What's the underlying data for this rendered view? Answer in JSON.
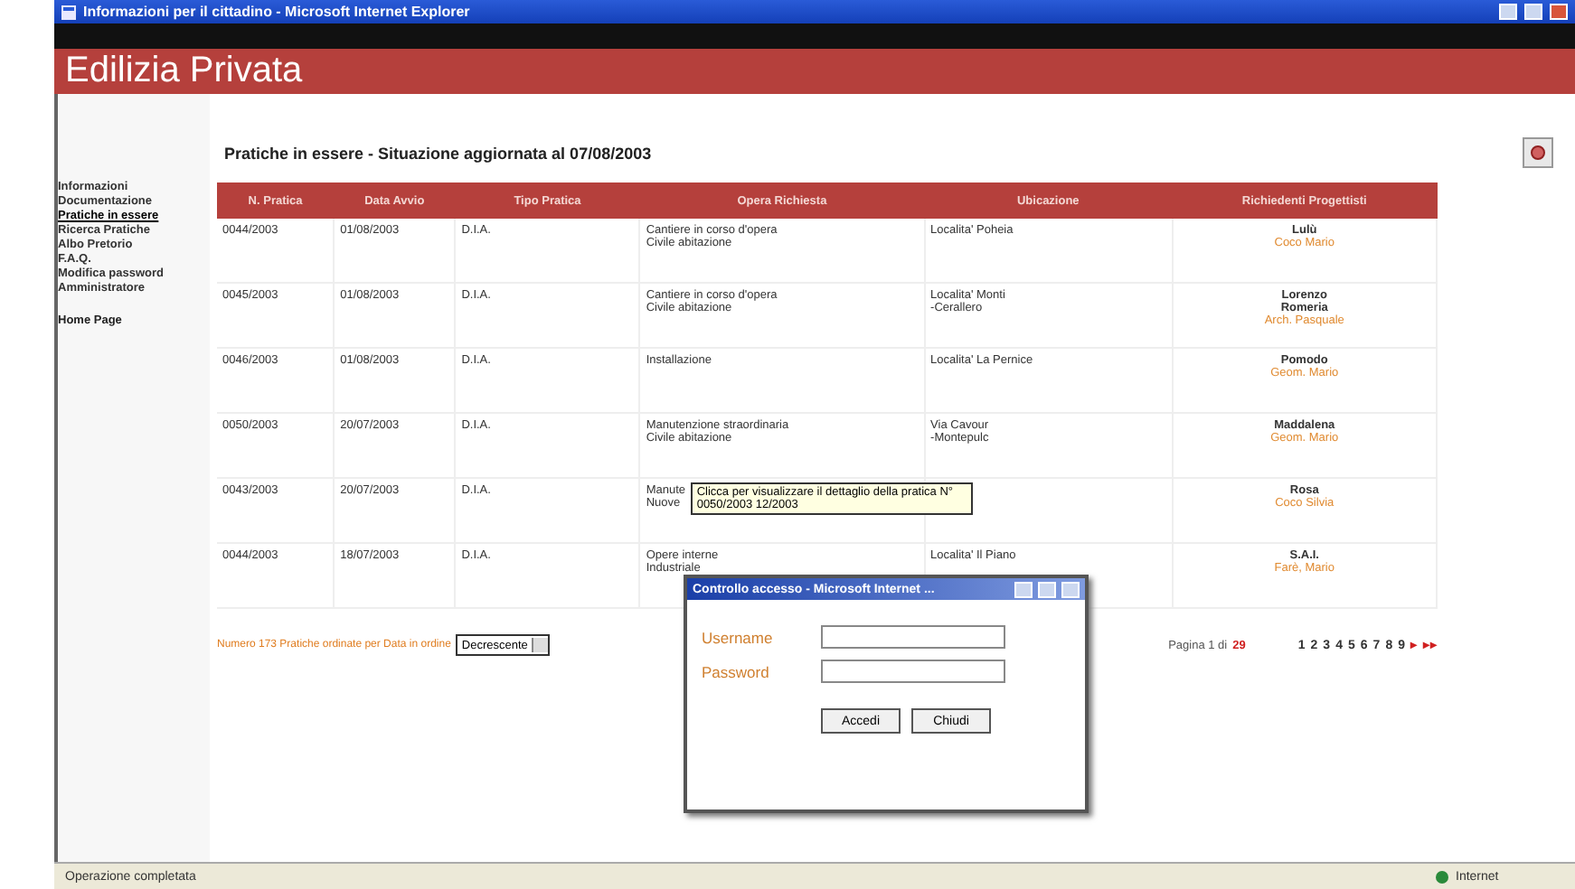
{
  "window": {
    "title": "Informazioni per il cittadino - Microsoft Internet Explorer"
  },
  "header": {
    "title": "Edilizia Privata"
  },
  "sidebar": {
    "items": [
      {
        "label": "Informazioni",
        "selected": false
      },
      {
        "label": "Documentazione",
        "selected": false
      },
      {
        "label": "Pratiche in essere",
        "selected": true
      },
      {
        "label": "Ricerca Pratiche",
        "selected": false
      },
      {
        "label": "Albo Pretorio",
        "selected": false
      },
      {
        "label": "F.A.Q.",
        "selected": false
      },
      {
        "label": "Modifica password",
        "selected": false
      },
      {
        "label": "Amministratore",
        "selected": false
      }
    ],
    "home": "Home Page"
  },
  "page_title": "Pratiche in essere - Situazione aggiornata al 07/08/2003",
  "table": {
    "columns": [
      "N. Pratica",
      "Data Avvio",
      "Tipo Pratica",
      "Opera Richiesta",
      "Ubicazione",
      "Richiedenti Progettisti"
    ],
    "rows": [
      {
        "number": "0044/2003",
        "date": "01/08/2003",
        "type": "D.I.A.",
        "opera": [
          "Cantiere in corso d'opera",
          "Civile abitazione"
        ],
        "location": [
          "Localita' Poheia"
        ],
        "applicant": "Lulù",
        "designer": "Coco Mario"
      },
      {
        "number": "0045/2003",
        "date": "01/08/2003",
        "type": "D.I.A.",
        "opera": [
          "Cantiere in corso d'opera",
          "Civile abitazione"
        ],
        "location": [
          "Localita' Monti",
          "-Cerallero"
        ],
        "applicant": "Lorenzo\nRomeria",
        "designer": "Arch. Pasquale"
      },
      {
        "number": "0046/2003",
        "date": "01/08/2003",
        "type": "D.I.A.",
        "opera": [
          "Installazione"
        ],
        "location": [
          "Localita' La Pernice"
        ],
        "applicant": "Pomodo",
        "designer": "Geom. Mario"
      },
      {
        "number": "0050/2003",
        "date": "20/07/2003",
        "type": "D.I.A.",
        "opera": [
          "Manutenzione straordinaria",
          "Civile abitazione"
        ],
        "location": [
          "Via Cavour",
          "-Montepulc"
        ],
        "applicant": "Maddalena",
        "designer": "Geom. Mario"
      },
      {
        "number": "0043/2003",
        "date": "20/07/2003",
        "type": "D.I.A.",
        "opera": [
          "Manute",
          "Nuove"
        ],
        "location": [],
        "applicant": "Rosa",
        "designer": "Coco Silvia",
        "tooltip": "Clicca per visualizzare il dettaglio della pratica N° 0050/2003 12/2003"
      },
      {
        "number": "0044/2003",
        "date": "18/07/2003",
        "type": "D.I.A.",
        "opera": [
          "Opere interne",
          "Industriale"
        ],
        "location": [
          "Localita' Il Piano"
        ],
        "applicant": "S.A.I.",
        "designer": "Farè, Mario"
      }
    ]
  },
  "footer": {
    "summary": "Numero 173 Pratiche ordinate per Data in ordine",
    "order": "Decrescente",
    "page_label": "Pagina 1 di",
    "page_total": "29",
    "pages": [
      {
        "label": "1",
        "kind": "number"
      },
      {
        "label": "2",
        "kind": "number"
      },
      {
        "label": "3",
        "kind": "number"
      },
      {
        "label": "4",
        "kind": "number"
      },
      {
        "label": "5",
        "kind": "number"
      },
      {
        "label": "6",
        "kind": "number"
      },
      {
        "label": "7",
        "kind": "number"
      },
      {
        "label": "8",
        "kind": "number"
      },
      {
        "label": "9",
        "kind": "number"
      },
      {
        "label": "▸",
        "kind": "arrow"
      },
      {
        "label": "▸▸",
        "kind": "arrow"
      }
    ]
  },
  "dialog": {
    "title": "Controllo accesso - Microsoft Internet ...",
    "fields": [
      {
        "label": "Username"
      },
      {
        "label": "Password"
      }
    ],
    "buttons": [
      "Accedi",
      "Chiudi"
    ]
  },
  "status_bar": {
    "text": "Operazione completata",
    "zone": "Internet"
  }
}
